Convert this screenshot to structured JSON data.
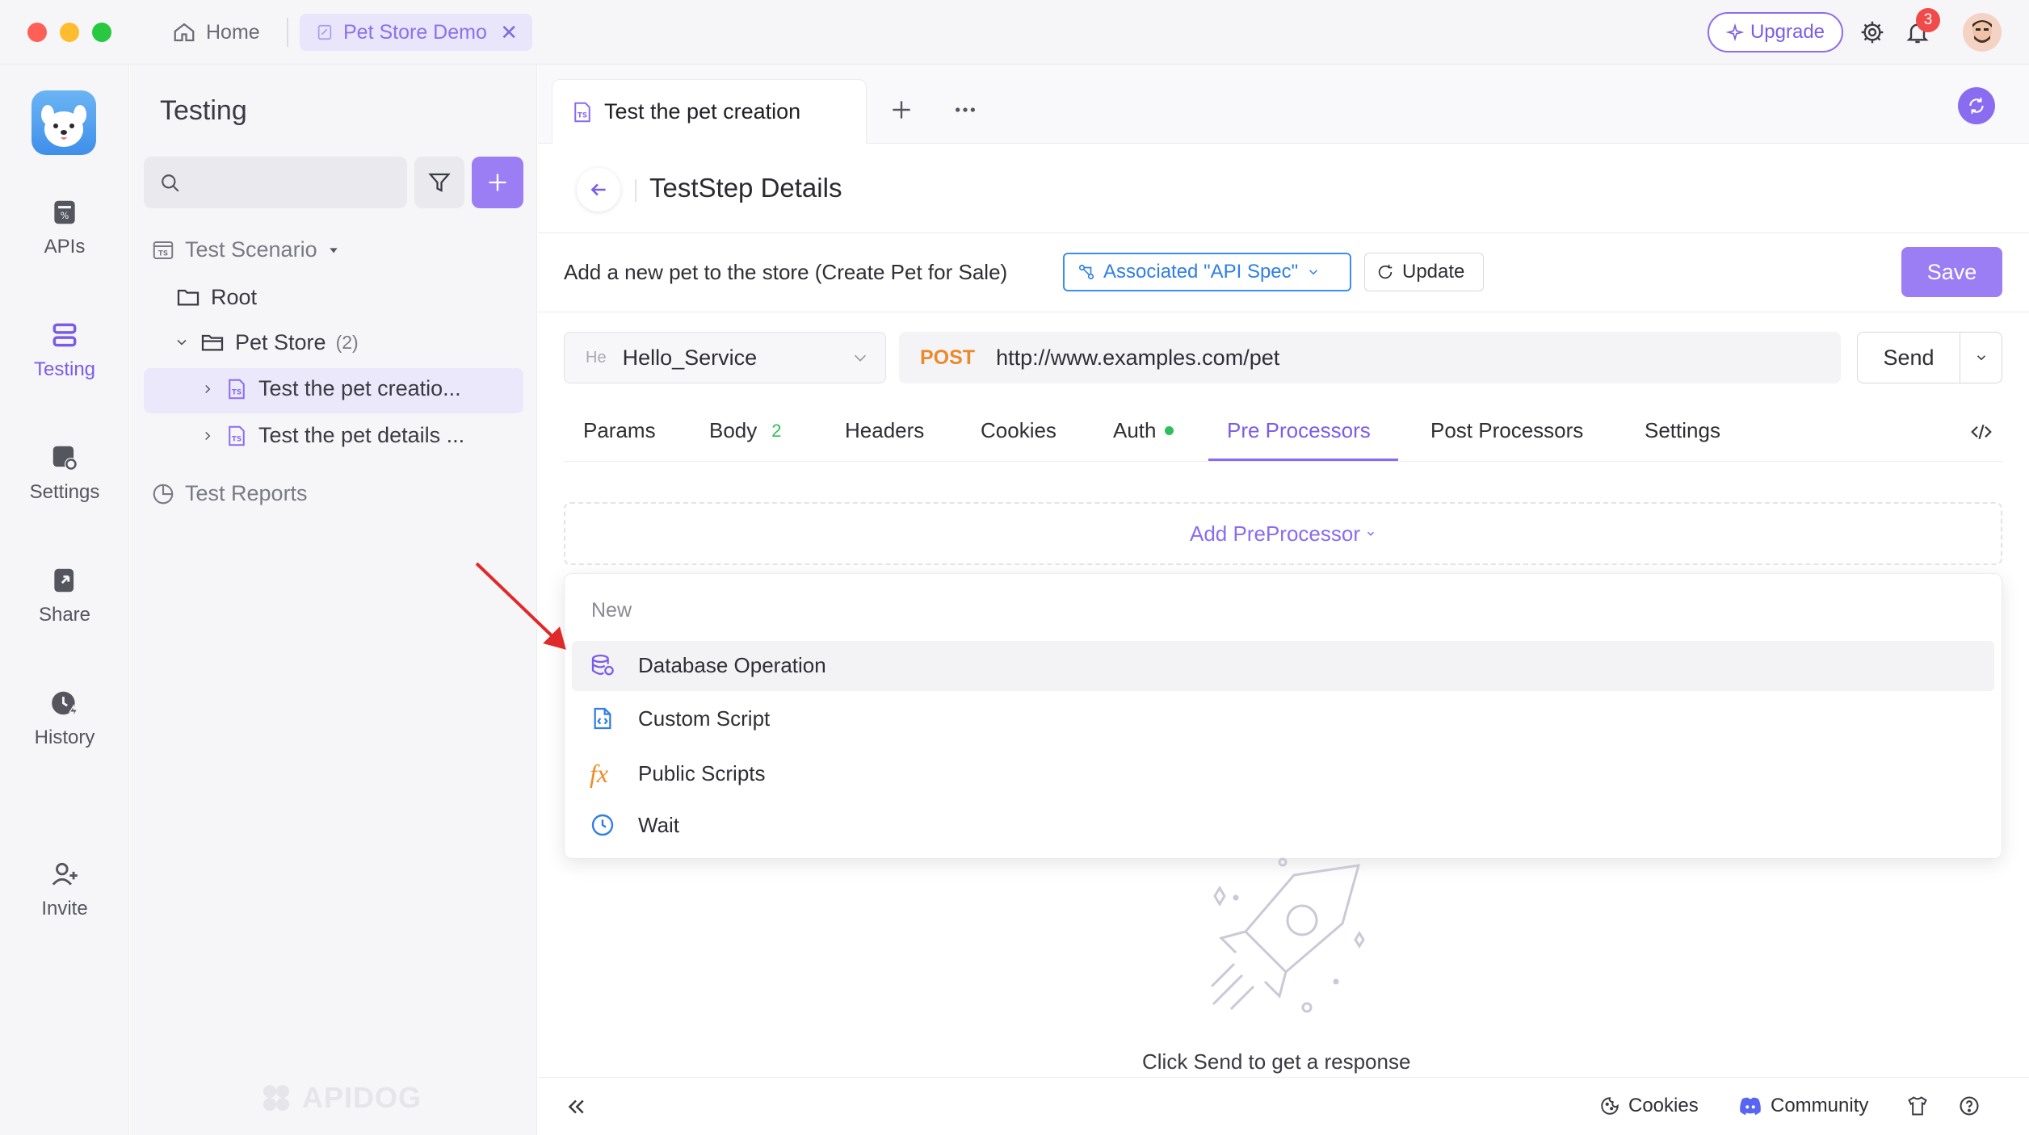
{
  "titlebar": {
    "home_label": "Home",
    "project_tab_label": "Pet Store Demo",
    "upgrade_label": "Upgrade",
    "notification_count": "3"
  },
  "nav": {
    "items": [
      {
        "label": "APIs",
        "icon": "apis-icon"
      },
      {
        "label": "Testing",
        "icon": "testing-icon"
      },
      {
        "label": "Settings",
        "icon": "settings-icon"
      },
      {
        "label": "Share",
        "icon": "share-icon"
      },
      {
        "label": "History",
        "icon": "history-icon"
      },
      {
        "label": "Invite",
        "icon": "invite-icon"
      }
    ],
    "active": "Testing"
  },
  "sidebar": {
    "title": "Testing",
    "tree": {
      "scenario_label": "Test Scenario",
      "root_label": "Root",
      "folder_label": "Pet Store",
      "folder_count": "(2)",
      "items": [
        "Test the pet creatio...",
        "Test the pet details ..."
      ],
      "reports_label": "Test Reports"
    },
    "watermark": "APIDOG"
  },
  "main": {
    "tab_label": "Test the pet creation",
    "tab_abbr": "TS",
    "details_title": "TestStep Details",
    "step_description": "Add a new pet to the store (Create Pet for Sale)",
    "associated_label": "Associated \"API Spec\"",
    "update_label": "Update",
    "save_label": "Save",
    "environment": {
      "abbr": "He",
      "value": "Hello_Service"
    },
    "request": {
      "method": "POST",
      "url": "http://www.examples.com/pet"
    },
    "send_label": "Send",
    "request_tabs": [
      {
        "label": "Params"
      },
      {
        "label": "Body",
        "count": "2"
      },
      {
        "label": "Headers"
      },
      {
        "label": "Cookies"
      },
      {
        "label": "Auth"
      },
      {
        "label": "Pre Processors"
      },
      {
        "label": "Post Processors"
      },
      {
        "label": "Settings"
      }
    ],
    "active_tab": "Pre Processors",
    "add_preprocessor_label": "Add PreProcessor",
    "dropdown": {
      "header": "New",
      "items": [
        {
          "label": "Database Operation",
          "icon": "database-icon"
        },
        {
          "label": "Custom Script",
          "icon": "script-file-icon"
        },
        {
          "label": "Public Scripts",
          "icon": "fx-icon"
        },
        {
          "label": "Wait",
          "icon": "clock-icon"
        }
      ]
    },
    "empty_state": "Click Send to get a response",
    "fx_glyph": "fx"
  },
  "bottombar": {
    "cookies_label": "Cookies",
    "community_label": "Community"
  },
  "colors": {
    "accent": "#8a6cf0",
    "post": "#ea8a2c",
    "link_blue": "#2f7fe6",
    "auth_dot": "#2fbf5a"
  }
}
